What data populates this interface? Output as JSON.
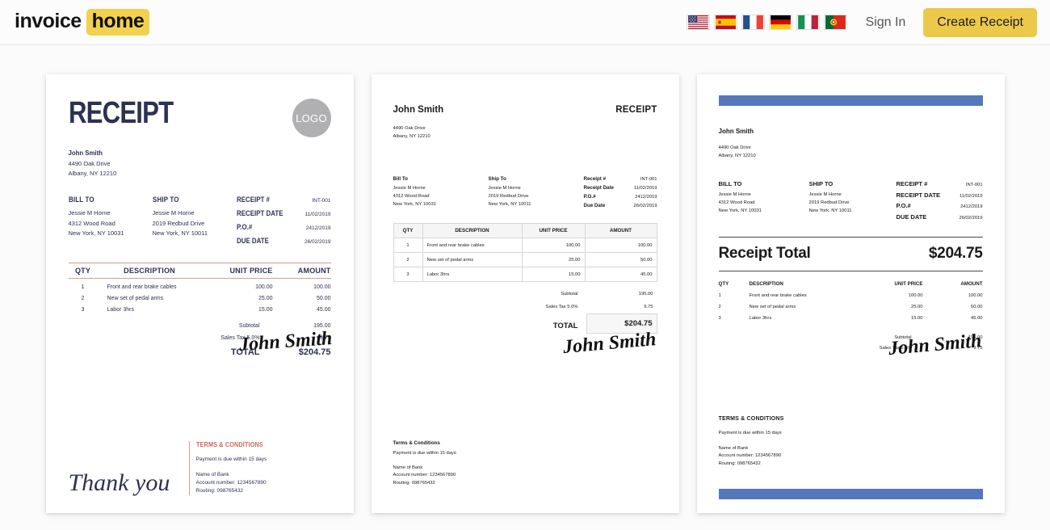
{
  "header": {
    "logo_word1": "invoice",
    "logo_word2": "home",
    "sign_in_label": "Sign In",
    "create_receipt_label": "Create Receipt",
    "flags": [
      {
        "name": "flag-usa",
        "label": "United States"
      },
      {
        "name": "flag-spain",
        "label": "Spain"
      },
      {
        "name": "flag-france",
        "label": "France"
      },
      {
        "name": "flag-germany",
        "label": "Germany"
      },
      {
        "name": "flag-italy",
        "label": "Italy"
      },
      {
        "name": "flag-portugal",
        "label": "Portugal"
      }
    ],
    "colors": {
      "accent_yellow": "#edc94a",
      "logo_highlight": "#f2d14e"
    }
  },
  "shared": {
    "sender": {
      "name": "John Smith",
      "address1": "4490 Oak Drive",
      "address2": "Albany, NY 12210"
    },
    "bill_to": {
      "heading_caps": "BILL TO",
      "heading_title": "Bill To",
      "name": "Jessie M Horne",
      "address1": "4312 Wood Road",
      "address2": "New York, NY 10031"
    },
    "ship_to": {
      "heading_caps": "SHIP TO",
      "heading_title": "Ship To",
      "name": "Jessie M Horne",
      "address1": "2019 Redbud Drive",
      "address2": "New York, NY 10011"
    },
    "meta": {
      "receipt_no_caps": "RECEIPT #",
      "receipt_no_title": "Receipt #",
      "receipt_no_value": "INT-001",
      "receipt_date_caps": "RECEIPT DATE",
      "receipt_date_title": "Receipt Date",
      "receipt_date_value": "11/02/2019",
      "po_caps": "P.O.#",
      "po_title": "P.O.#",
      "po_value": "2412/2019",
      "due_date_caps": "DUE DATE",
      "due_date_title": "Due Date",
      "due_date_value": "26/02/2019"
    },
    "table_headers": {
      "qty": "QTY",
      "description": "DESCRIPTION",
      "unit_price": "UNIT PRICE",
      "amount": "AMOUNT"
    },
    "line_items": [
      {
        "qty": "1",
        "description": "Front and rear brake cables",
        "unit_price": "100.00",
        "amount": "100.00"
      },
      {
        "qty": "2",
        "description": "New set of pedal arms",
        "unit_price": "25.00",
        "amount": "50.00"
      },
      {
        "qty": "3",
        "description": "Labor 3hrs",
        "unit_price": "15.00",
        "amount": "45.00"
      }
    ],
    "totals": {
      "subtotal_label": "Subtotal",
      "subtotal_value": "195.00",
      "tax_label": "Sales Tax 5.0%",
      "tax_value": "9.75",
      "total_label": "TOTAL",
      "total_value": "$204.75"
    },
    "terms": {
      "heading_caps": "TERMS & CONDITIONS",
      "heading_title": "Terms & Conditions",
      "payment_note": "Payment is due within 15 days",
      "bank_name": "Name of Bank",
      "account_number": "Account number: 1234567890",
      "routing": "Routing: 098765432"
    },
    "signature": "John Smith"
  },
  "templates": [
    {
      "id": "template-classic-navy",
      "title": "RECEIPT",
      "logo_placeholder": "LOGO",
      "thank_you": "Thank you",
      "accent_color": "#c9685c",
      "text_color": "#2c3154"
    },
    {
      "id": "template-minimal-bordered",
      "title": "RECEIPT",
      "accent_color": "#d7d7d7",
      "text_color": "#1a1a1a"
    },
    {
      "id": "template-blue-bar",
      "receipt_total_label": "Receipt Total",
      "receipt_total_value": "$204.75",
      "accent_color": "#5578bd",
      "text_color": "#1a1a1a"
    }
  ]
}
